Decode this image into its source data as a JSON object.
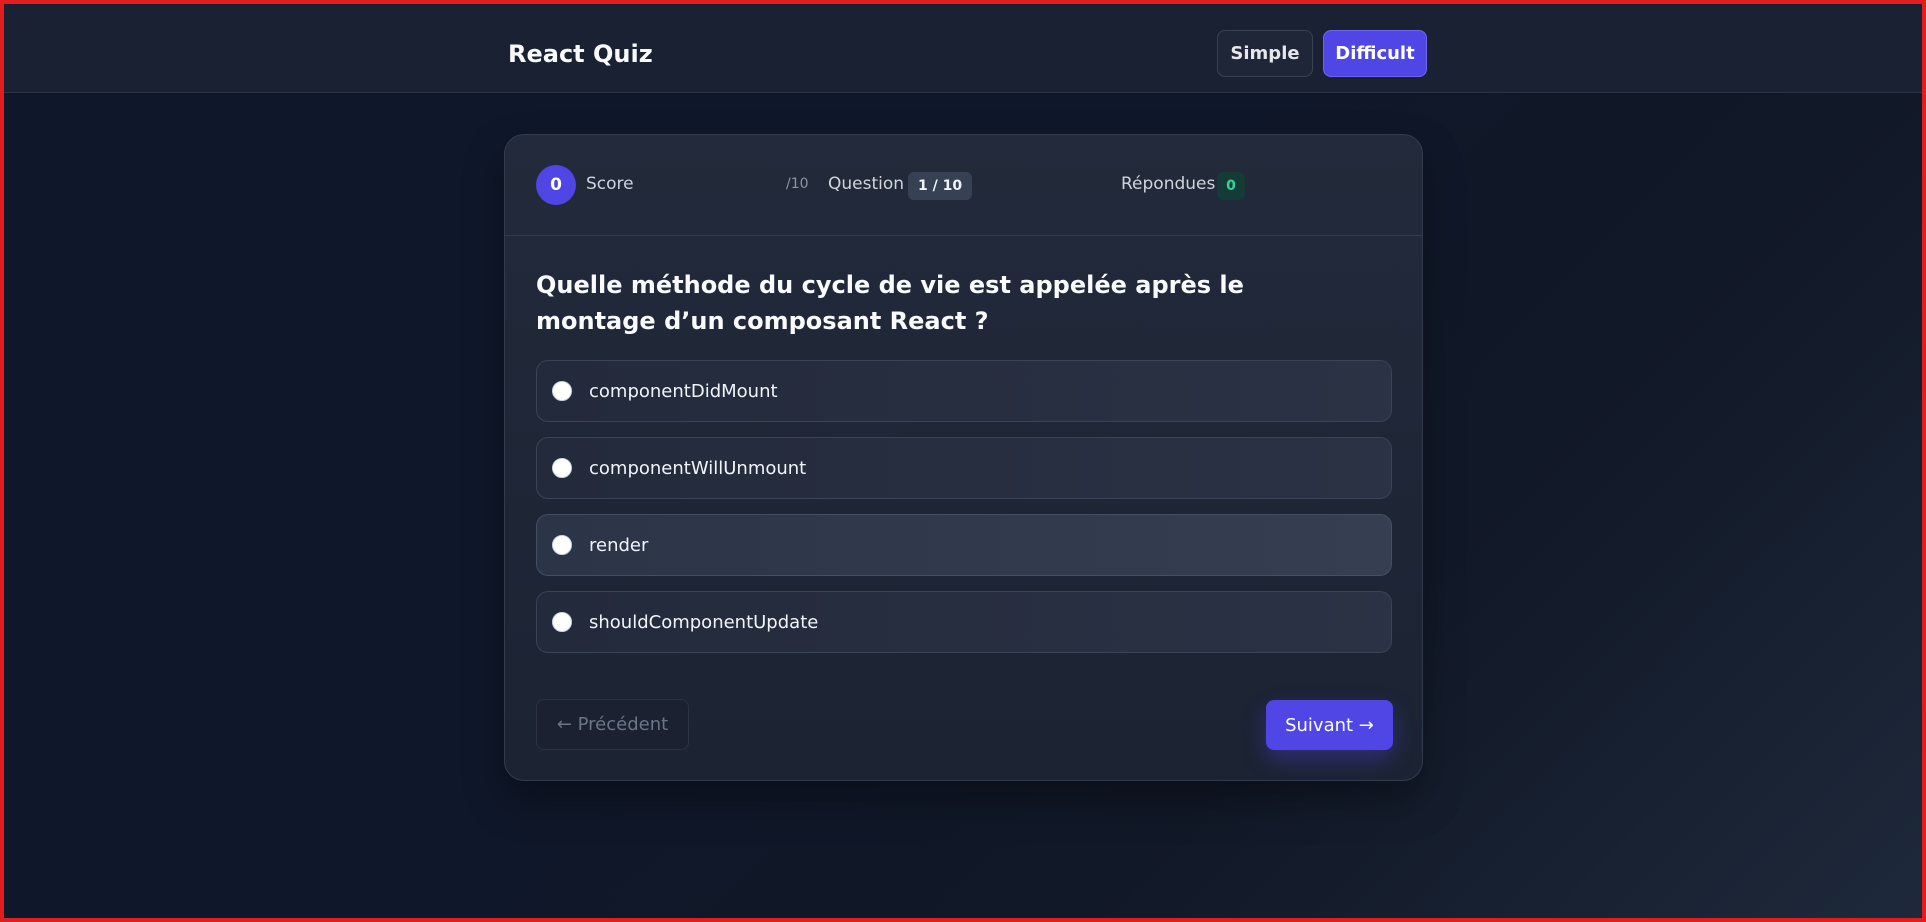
{
  "app": {
    "title": "React Quiz"
  },
  "modes": {
    "simple_label": "Simple",
    "difficult_label": "Difficult",
    "active": "Difficult"
  },
  "status": {
    "score_value": "0",
    "score_label": "Score",
    "score_total": "/10",
    "question_label": "Question",
    "question_progress": "1 / 10",
    "answered_label": "Répondues",
    "answered_value": "0"
  },
  "question": {
    "text": "Quelle méthode du cycle de vie est appelée après le montage d’un composant React ?",
    "options": [
      {
        "label": "componentDidMount"
      },
      {
        "label": "componentWillUnmount"
      },
      {
        "label": "render"
      },
      {
        "label": "shouldComponentUpdate"
      }
    ]
  },
  "navigation": {
    "prev_label": "← Précédent",
    "next_label": "Suivant →"
  },
  "colors": {
    "accent": "#4f46e5",
    "background": "#0f172a",
    "card": "#1f2637",
    "answered_badge": "#34d399",
    "window_border": "#e11d1d"
  }
}
